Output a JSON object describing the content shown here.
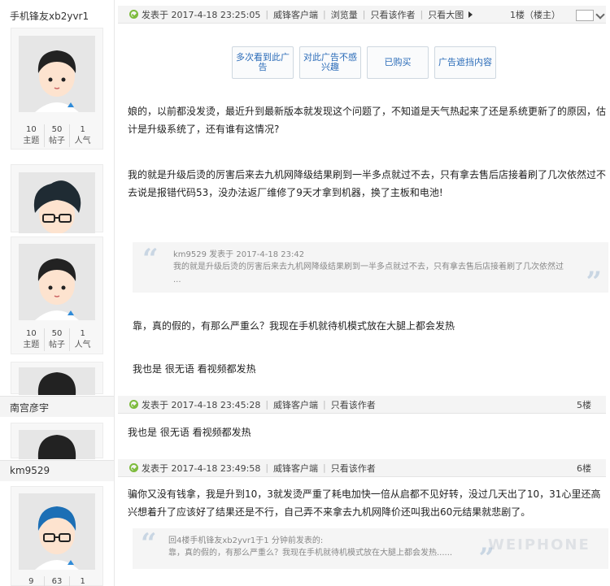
{
  "users": [
    {
      "name": "手机锋友xb2yvr1",
      "stats": [
        {
          "num": "10",
          "label": "主题"
        },
        {
          "num": "50",
          "label": "帖子"
        },
        {
          "num": "1",
          "label": "人气"
        }
      ]
    },
    {
      "name": "",
      "stats": [
        {
          "num": "10",
          "label": "主题"
        },
        {
          "num": "50",
          "label": "帖子"
        },
        {
          "num": "1",
          "label": "人气"
        }
      ]
    },
    {
      "name": "南宫彦宇"
    },
    {
      "name": "km9529",
      "stats": [
        {
          "num": "9",
          "label": ""
        },
        {
          "num": "63",
          "label": ""
        },
        {
          "num": "1",
          "label": ""
        }
      ]
    }
  ],
  "post1": {
    "posted": "发表于 2017-4-18 23:25:05",
    "client": "威锋客户端",
    "views": "浏览量",
    "author_only": "只看该作者",
    "big_image": "只看大图",
    "floor": "1楼（楼主）",
    "ad_buttons": [
      "多次看到此广告",
      "对此广告不感兴趣",
      "已购买",
      "广告遮挡内容"
    ],
    "text": "娘的，以前都没发烫，最近升到最新版本就发现这个问题了，不知道是天气热起来了还是系统更新了的原因，估计是升级系统了，还有谁有这情况?"
  },
  "post2": {
    "text": "我的就是升级后烫的厉害后来去九机网降级结果刷到一半多点就过不去，只有拿去售后店接着刷了几次依然过不去说是报错代码53，没办法返厂维修了9天才拿到机器，换了主板和电池!"
  },
  "post3": {
    "quote_author": "km9529 发表于 2017-4-18 23:42",
    "quote_text": "我的就是升级后烫的厉害后来去九机网降级结果刷到一半多点就过不去，只有拿去售后店接着刷了几次依然过不去",
    "quote_more": "...",
    "text": "靠，真的假的，有那么严重么？我现在手机就待机模式放在大腿上都会发热"
  },
  "post4": {
    "text": "我也是 很无语 看视频都发热"
  },
  "post5": {
    "posted": "发表于 2017-4-18 23:45:28",
    "client": "威锋客户端",
    "author_only": "只看该作者",
    "floor": "5楼",
    "text": "我也是 很无语 看视频都发热"
  },
  "post6": {
    "posted": "发表于 2017-4-18 23:49:58",
    "client": "威锋客户端",
    "author_only": "只看该作者",
    "floor": "6楼",
    "text": "骗你又没有钱拿，我是升到10，3就发烫严重了耗电加快一倍从启都不见好转，没过几天出了10，31心里还高兴想着升了应该好了结果还是不行，自己弄不来拿去九机网降价还叫我出60元结果就悲剧了。",
    "quote_author": "回4楼手机锋友xb2yvr1于1 分钟前发表的:",
    "quote_text": "靠，真的假的，有那么严重么？我现在手机就待机模式放在大腿上都会发热......"
  },
  "watermark": "WEIPHONE"
}
